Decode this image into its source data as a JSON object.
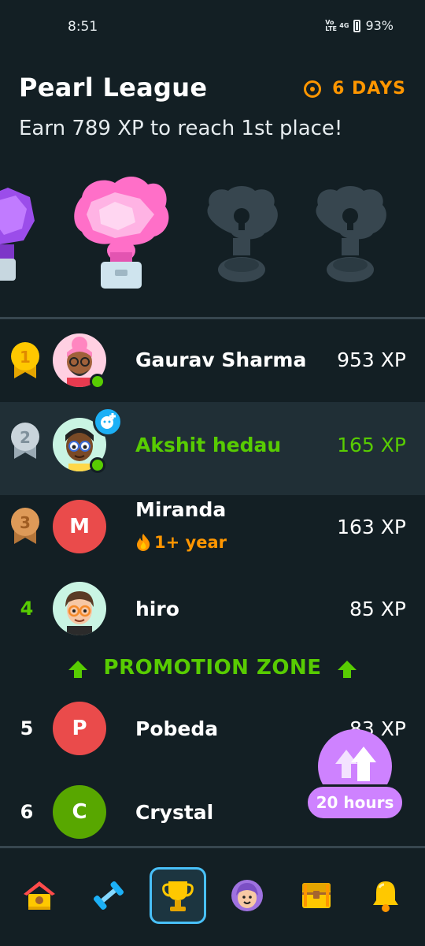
{
  "status_bar": {
    "time": "8:51",
    "volte": "Vo LTE",
    "network": "4G",
    "battery": "93%"
  },
  "header": {
    "title": "Pearl League",
    "days_left": "6 DAYS",
    "subtitle": "Earn 789 XP to reach 1st place!"
  },
  "trophies": [
    {
      "name": "amethyst-league-icon",
      "state": "unlocked",
      "color": "#b46bff"
    },
    {
      "name": "pearl-league-icon",
      "state": "current",
      "color": "#ff8fd6"
    },
    {
      "name": "locked-league-icon",
      "state": "locked",
      "color": "#37464f"
    },
    {
      "name": "locked-league-icon",
      "state": "locked",
      "color": "#37464f"
    }
  ],
  "leaderboard": [
    {
      "rank": "1",
      "name": "Gaurav Sharma",
      "xp": "953 XP",
      "avatar": "avatar-gaurav",
      "online": true
    },
    {
      "rank": "2",
      "name": "Akshit hedau",
      "xp": "165 XP",
      "avatar": "avatar-akshit",
      "online": true,
      "is_current_user": true
    },
    {
      "rank": "3",
      "name": "Miranda",
      "xp": "163 XP",
      "avatar_letter": "M",
      "avatar_color": "#ea4b4b",
      "streak": "1+ year"
    },
    {
      "rank": "4",
      "name": "hiro",
      "xp": "85 XP",
      "avatar": "avatar-hiro"
    },
    {
      "rank": "5",
      "name": "Pobeda",
      "xp": "83 XP",
      "avatar_letter": "P",
      "avatar_color": "#ea4b4b"
    },
    {
      "rank": "6",
      "name": "Crystal",
      "xp": "",
      "avatar_letter": "C",
      "avatar_color": "#58a700"
    }
  ],
  "promotion_zone": {
    "label": "PROMOTION ZONE"
  },
  "boost": {
    "label": "20 hours"
  },
  "nav": [
    {
      "name": "home-icon"
    },
    {
      "name": "practice-dumbbell-icon"
    },
    {
      "name": "leaderboard-trophy-icon",
      "active": true
    },
    {
      "name": "profile-icon"
    },
    {
      "name": "shop-chest-icon"
    },
    {
      "name": "notifications-bell-icon"
    }
  ],
  "colors": {
    "background": "#131f24",
    "green": "#58cc02",
    "orange": "#ff9600",
    "active_blue": "#49c0f8",
    "purple": "#ce82ff"
  }
}
